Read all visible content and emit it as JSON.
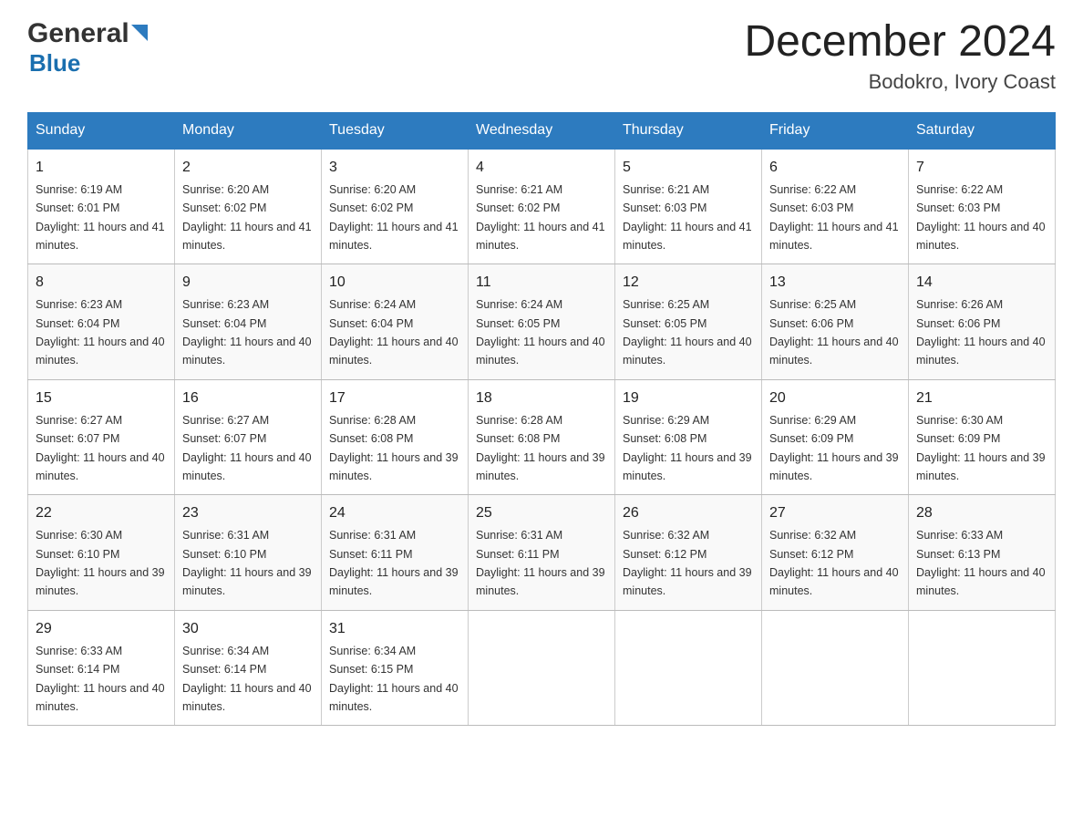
{
  "header": {
    "logo_general": "General",
    "logo_blue": "Blue",
    "month_title": "December 2024",
    "location": "Bodokro, Ivory Coast"
  },
  "days_of_week": [
    "Sunday",
    "Monday",
    "Tuesday",
    "Wednesday",
    "Thursday",
    "Friday",
    "Saturday"
  ],
  "weeks": [
    [
      {
        "day": "1",
        "sunrise": "6:19 AM",
        "sunset": "6:01 PM",
        "daylight": "11 hours and 41 minutes."
      },
      {
        "day": "2",
        "sunrise": "6:20 AM",
        "sunset": "6:02 PM",
        "daylight": "11 hours and 41 minutes."
      },
      {
        "day": "3",
        "sunrise": "6:20 AM",
        "sunset": "6:02 PM",
        "daylight": "11 hours and 41 minutes."
      },
      {
        "day": "4",
        "sunrise": "6:21 AM",
        "sunset": "6:02 PM",
        "daylight": "11 hours and 41 minutes."
      },
      {
        "day": "5",
        "sunrise": "6:21 AM",
        "sunset": "6:03 PM",
        "daylight": "11 hours and 41 minutes."
      },
      {
        "day": "6",
        "sunrise": "6:22 AM",
        "sunset": "6:03 PM",
        "daylight": "11 hours and 41 minutes."
      },
      {
        "day": "7",
        "sunrise": "6:22 AM",
        "sunset": "6:03 PM",
        "daylight": "11 hours and 40 minutes."
      }
    ],
    [
      {
        "day": "8",
        "sunrise": "6:23 AM",
        "sunset": "6:04 PM",
        "daylight": "11 hours and 40 minutes."
      },
      {
        "day": "9",
        "sunrise": "6:23 AM",
        "sunset": "6:04 PM",
        "daylight": "11 hours and 40 minutes."
      },
      {
        "day": "10",
        "sunrise": "6:24 AM",
        "sunset": "6:04 PM",
        "daylight": "11 hours and 40 minutes."
      },
      {
        "day": "11",
        "sunrise": "6:24 AM",
        "sunset": "6:05 PM",
        "daylight": "11 hours and 40 minutes."
      },
      {
        "day": "12",
        "sunrise": "6:25 AM",
        "sunset": "6:05 PM",
        "daylight": "11 hours and 40 minutes."
      },
      {
        "day": "13",
        "sunrise": "6:25 AM",
        "sunset": "6:06 PM",
        "daylight": "11 hours and 40 minutes."
      },
      {
        "day": "14",
        "sunrise": "6:26 AM",
        "sunset": "6:06 PM",
        "daylight": "11 hours and 40 minutes."
      }
    ],
    [
      {
        "day": "15",
        "sunrise": "6:27 AM",
        "sunset": "6:07 PM",
        "daylight": "11 hours and 40 minutes."
      },
      {
        "day": "16",
        "sunrise": "6:27 AM",
        "sunset": "6:07 PM",
        "daylight": "11 hours and 40 minutes."
      },
      {
        "day": "17",
        "sunrise": "6:28 AM",
        "sunset": "6:08 PM",
        "daylight": "11 hours and 39 minutes."
      },
      {
        "day": "18",
        "sunrise": "6:28 AM",
        "sunset": "6:08 PM",
        "daylight": "11 hours and 39 minutes."
      },
      {
        "day": "19",
        "sunrise": "6:29 AM",
        "sunset": "6:08 PM",
        "daylight": "11 hours and 39 minutes."
      },
      {
        "day": "20",
        "sunrise": "6:29 AM",
        "sunset": "6:09 PM",
        "daylight": "11 hours and 39 minutes."
      },
      {
        "day": "21",
        "sunrise": "6:30 AM",
        "sunset": "6:09 PM",
        "daylight": "11 hours and 39 minutes."
      }
    ],
    [
      {
        "day": "22",
        "sunrise": "6:30 AM",
        "sunset": "6:10 PM",
        "daylight": "11 hours and 39 minutes."
      },
      {
        "day": "23",
        "sunrise": "6:31 AM",
        "sunset": "6:10 PM",
        "daylight": "11 hours and 39 minutes."
      },
      {
        "day": "24",
        "sunrise": "6:31 AM",
        "sunset": "6:11 PM",
        "daylight": "11 hours and 39 minutes."
      },
      {
        "day": "25",
        "sunrise": "6:31 AM",
        "sunset": "6:11 PM",
        "daylight": "11 hours and 39 minutes."
      },
      {
        "day": "26",
        "sunrise": "6:32 AM",
        "sunset": "6:12 PM",
        "daylight": "11 hours and 39 minutes."
      },
      {
        "day": "27",
        "sunrise": "6:32 AM",
        "sunset": "6:12 PM",
        "daylight": "11 hours and 40 minutes."
      },
      {
        "day": "28",
        "sunrise": "6:33 AM",
        "sunset": "6:13 PM",
        "daylight": "11 hours and 40 minutes."
      }
    ],
    [
      {
        "day": "29",
        "sunrise": "6:33 AM",
        "sunset": "6:14 PM",
        "daylight": "11 hours and 40 minutes."
      },
      {
        "day": "30",
        "sunrise": "6:34 AM",
        "sunset": "6:14 PM",
        "daylight": "11 hours and 40 minutes."
      },
      {
        "day": "31",
        "sunrise": "6:34 AM",
        "sunset": "6:15 PM",
        "daylight": "11 hours and 40 minutes."
      },
      null,
      null,
      null,
      null
    ]
  ],
  "labels": {
    "sunrise": "Sunrise:",
    "sunset": "Sunset:",
    "daylight": "Daylight:"
  }
}
